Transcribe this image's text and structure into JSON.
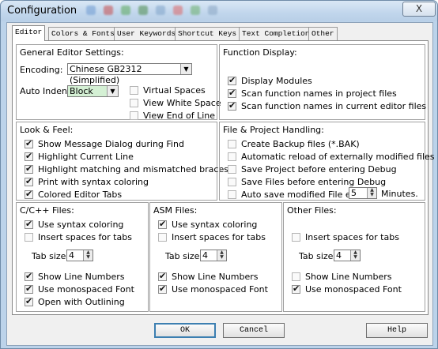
{
  "window": {
    "title": "Configuration",
    "close_glyph": "X"
  },
  "tabs": [
    {
      "label": "Editor",
      "active": true
    },
    {
      "label": "Colors & Fonts",
      "active": false
    },
    {
      "label": "User Keywords",
      "active": false
    },
    {
      "label": "Shortcut Keys",
      "active": false
    },
    {
      "label": "Text Completion",
      "active": false
    },
    {
      "label": "Other",
      "active": false
    }
  ],
  "general": {
    "header": "General Editor Settings:",
    "encoding_label": "Encoding:",
    "encoding_value": "Chinese GB2312 (Simplified)",
    "indent_label": "Auto Indent:",
    "indent_value": "Block",
    "options": [
      {
        "label": "Virtual Spaces",
        "checked": false
      },
      {
        "label": "View White Space",
        "checked": false
      },
      {
        "label": "View End of Line",
        "checked": false
      }
    ]
  },
  "function_display": {
    "header": "Function Display:",
    "options": [
      {
        "label": "Display Modules",
        "checked": true
      },
      {
        "label": "Scan function names in project files",
        "checked": true
      },
      {
        "label": "Scan function names in current editor files",
        "checked": true
      }
    ]
  },
  "look_feel": {
    "header": "Look & Feel:",
    "options": [
      {
        "label": "Show Message Dialog during Find",
        "checked": true
      },
      {
        "label": "Highlight Current Line",
        "checked": true
      },
      {
        "label": "Highlight matching and mismatched braces",
        "checked": true
      },
      {
        "label": "Print with syntax coloring",
        "checked": true
      },
      {
        "label": "Colored Editor Tabs",
        "checked": true
      }
    ]
  },
  "file_project": {
    "header": "File & Project Handling:",
    "options": [
      {
        "label": "Create Backup files (*.BAK)",
        "checked": false
      },
      {
        "label": "Automatic reload of externally modified files",
        "checked": false
      },
      {
        "label": "Save Project before entering Debug",
        "checked": false
      },
      {
        "label": "Save Files before entering Debug",
        "checked": false
      },
      {
        "label": "Auto save modified File every",
        "checked": false
      }
    ],
    "autosave_value": "5",
    "autosave_unit": "Minutes."
  },
  "cpp_files": {
    "header": "C/C++ Files:",
    "syntax": {
      "label": "Use syntax coloring",
      "checked": true
    },
    "insert_spaces": {
      "label": "Insert spaces for tabs",
      "checked": false
    },
    "tab_size_label": "Tab size:",
    "tab_size": "4",
    "line_numbers": {
      "label": "Show Line Numbers",
      "checked": true
    },
    "monospaced": {
      "label": "Use monospaced Font",
      "checked": true
    },
    "outlining": {
      "label": "Open with Outlining",
      "checked": true
    }
  },
  "asm_files": {
    "header": "ASM Files:",
    "syntax": {
      "label": "Use syntax coloring",
      "checked": true
    },
    "insert_spaces": {
      "label": "Insert spaces for tabs",
      "checked": false
    },
    "tab_size_label": "Tab size:",
    "tab_size": "4",
    "line_numbers": {
      "label": "Show Line Numbers",
      "checked": true
    },
    "monospaced": {
      "label": "Use monospaced Font",
      "checked": true
    }
  },
  "other_files": {
    "header": "Other Files:",
    "insert_spaces": {
      "label": "Insert spaces for tabs",
      "checked": false
    },
    "tab_size_label": "Tab size:",
    "tab_size": "4",
    "line_numbers": {
      "label": "Show Line Numbers",
      "checked": false
    },
    "monospaced": {
      "label": "Use monospaced Font",
      "checked": true
    }
  },
  "buttons": {
    "ok": "OK",
    "cancel": "Cancel",
    "help": "Help"
  },
  "colors": {
    "title_bar": "#c1d6ec",
    "indent_combo_bg": "#d4f0d4",
    "default_button_border": "#3c7fb1"
  }
}
